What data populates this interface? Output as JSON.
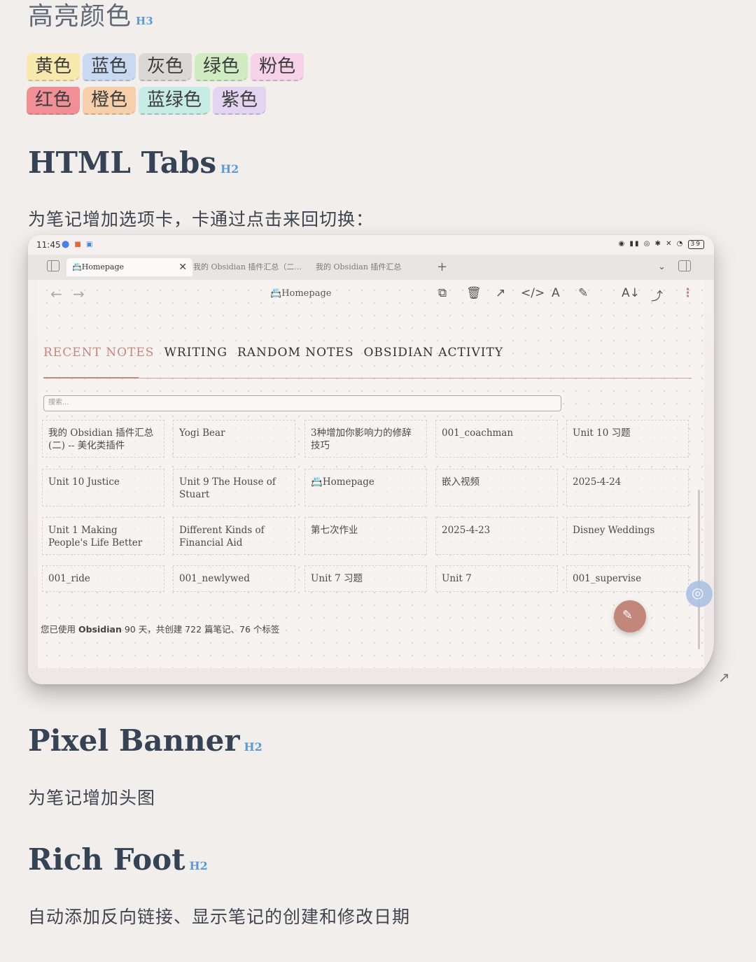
{
  "highlight_section": {
    "title": "高亮颜色",
    "level": "H3",
    "chips": [
      {
        "label": "黄色",
        "color": "#f8e9ac"
      },
      {
        "label": "蓝色",
        "color": "#c8d9f1"
      },
      {
        "label": "灰色",
        "color": "#dad7d4"
      },
      {
        "label": "绿色",
        "color": "#d1ecc3"
      },
      {
        "label": "粉色",
        "color": "#f6d3e8"
      },
      {
        "label": "红色",
        "color": "#f08f96"
      },
      {
        "label": "橙色",
        "color": "#f6d0aa"
      },
      {
        "label": "蓝绿色",
        "color": "#c7ebe5"
      },
      {
        "label": "紫色",
        "color": "#e3d4f2"
      }
    ]
  },
  "html_tabs_section": {
    "title": "HTML Tabs",
    "level": "H2",
    "description": "为笔记增加选项卡，卡通过点击来回切换："
  },
  "device": {
    "status_time": "11:45",
    "battery": "39",
    "tabs": [
      {
        "label": "Homepage",
        "icon": "homepage-icon",
        "active": true
      },
      {
        "label": "我的 Obsidian 插件汇总（二...",
        "active": false
      },
      {
        "label": "我的 Obsidian 插件汇总",
        "active": false
      }
    ],
    "view_title": "Homepage",
    "note_tabs": [
      "RECENT NOTES",
      "WRITING",
      "RANDOM NOTES",
      "OBSIDIAN ACTIVITY"
    ],
    "active_note_tab": "RECENT NOTES",
    "search_placeholder": "搜索...",
    "notes": [
      "我的 Obsidian 插件汇总(二) -- 美化类插件",
      "Yogi Bear",
      "3种增加你影响力的修辞技巧",
      "001_coachman",
      "Unit 10 习题",
      "Unit 10 Justice",
      "Unit 9 The House of Stuart",
      "Homepage",
      "嵌入视频",
      "2025-4-24",
      "Unit 1 Making People's Life Better",
      "Different Kinds of Financial Aid",
      "第七次作业",
      "2025-4-23",
      "Disney Weddings",
      "001_ride",
      "001_newlywed",
      "Unit 7 习题",
      "Unit 7",
      "001_supervise"
    ],
    "footer_pre": "您已使用 ",
    "footer_app": "Obsidian",
    "footer_post": " 90 天，共创建 722 篇笔记、76 个标签",
    "accent_color": "#c8857c"
  },
  "pixel_banner_section": {
    "title": "Pixel Banner",
    "level": "H2",
    "description": "为笔记增加头图"
  },
  "rich_foot_section": {
    "title": "Rich Foot",
    "level": "H2",
    "description": "自动添加反向链接、显示笔记的创建和修改日期"
  }
}
